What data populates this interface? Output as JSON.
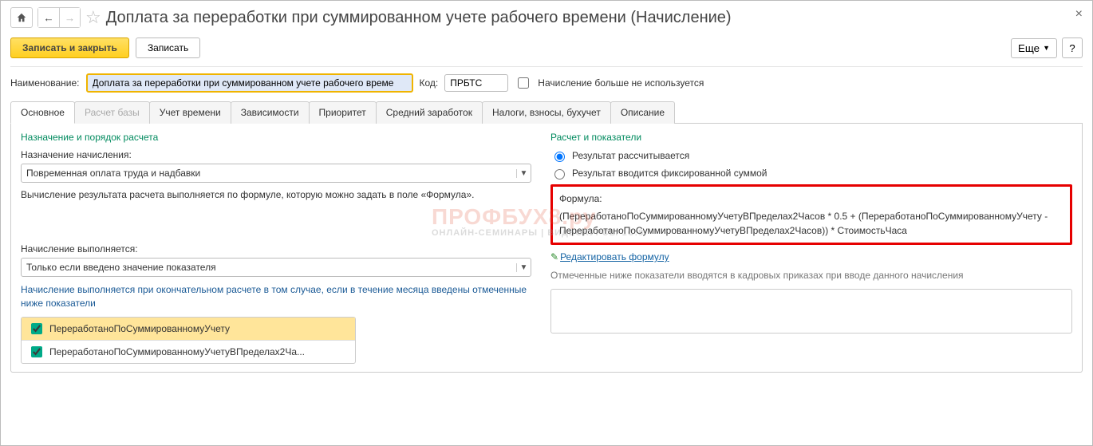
{
  "header": {
    "title": "Доплата за переработки при суммированном учете рабочего времени (Начисление)"
  },
  "toolbar": {
    "save_close": "Записать и закрыть",
    "save": "Записать",
    "more": "Еще",
    "help": "?"
  },
  "fields": {
    "name_label": "Наименование:",
    "name_value": "Доплата за переработки при суммированном учете рабочего време",
    "code_label": "Код:",
    "code_value": "ПРБТС",
    "not_used_label": "Начисление больше не используется"
  },
  "tabs": [
    {
      "label": "Основное",
      "active": true
    },
    {
      "label": "Расчет базы",
      "disabled": true
    },
    {
      "label": "Учет времени"
    },
    {
      "label": "Зависимости"
    },
    {
      "label": "Приоритет"
    },
    {
      "label": "Средний заработок"
    },
    {
      "label": "Налоги, взносы, бухучет"
    },
    {
      "label": "Описание"
    }
  ],
  "left": {
    "section_title": "Назначение и порядок расчета",
    "assignment_label": "Назначение начисления:",
    "assignment_value": "Повременная оплата труда и надбавки",
    "calc_hint": "Вычисление результата расчета выполняется по формуле, которую можно задать в поле «Формула».",
    "exec_label": "Начисление выполняется:",
    "exec_value": "Только если введено значение показателя",
    "exec_hint": "Начисление выполняется при окончательном расчете в том случае, если в течение месяца введены отмеченные ниже показатели",
    "indicators": [
      {
        "label": "ПереработаноПоСуммированномуУчету",
        "hl": true
      },
      {
        "label": "ПереработаноПоСуммированномуУчетуВПределах2Ча..."
      }
    ]
  },
  "right": {
    "section_title": "Расчет и показатели",
    "radio1": "Результат рассчитывается",
    "radio2": "Результат вводится фиксированной суммой",
    "radio_selected": 0,
    "formula_label": "Формула:",
    "formula_text": "(ПереработаноПоСуммированномуУчетуВПределах2Часов * 0.5 + (ПереработаноПоСуммированномуУчету - ПереработаноПоСуммированномуУчетуВПределах2Часов)) * СтоимостьЧаса",
    "edit_link": "Редактировать формулу",
    "indicators_hint": "Отмеченные ниже показатели вводятся в кадровых приказах при вводе данного начисления"
  },
  "watermark": {
    "main": "ПРОФБУХ8.ру",
    "sub": "ОНЛАЙН-СЕМИНАРЫ | ВИДЕОКУРСЫ 1С:8"
  }
}
